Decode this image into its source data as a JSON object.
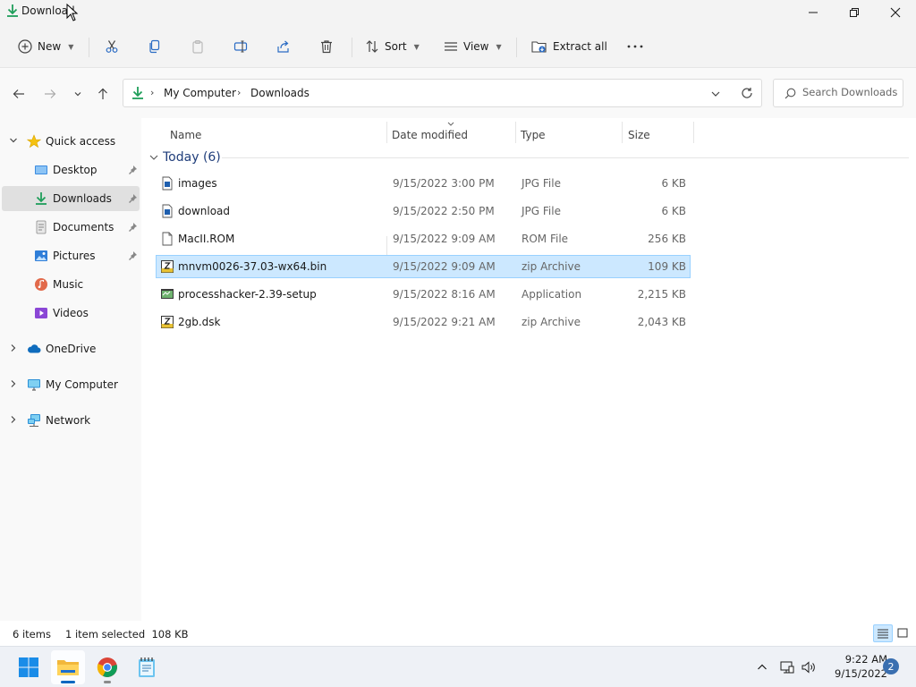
{
  "window": {
    "title": "Download"
  },
  "commandbar": {
    "new_label": "New",
    "sort_label": "Sort",
    "view_label": "View",
    "extract_label": "Extract all"
  },
  "address": {
    "crumbs": [
      "My Computer",
      "Downloads"
    ],
    "search_placeholder": "Search Downloads"
  },
  "sidebar": {
    "items": [
      {
        "label": "Quick access"
      },
      {
        "label": "Desktop"
      },
      {
        "label": "Downloads"
      },
      {
        "label": "Documents"
      },
      {
        "label": "Pictures"
      },
      {
        "label": "Music"
      },
      {
        "label": "Videos"
      },
      {
        "label": "OneDrive"
      },
      {
        "label": "My Computer"
      },
      {
        "label": "Network"
      }
    ]
  },
  "filelist": {
    "columns": [
      "Name",
      "Date modified",
      "Type",
      "Size"
    ],
    "group": "Today (6)",
    "rows": [
      {
        "name": "images",
        "date": "9/15/2022 3:00 PM",
        "type": "JPG File",
        "size": "6 KB"
      },
      {
        "name": "download",
        "date": "9/15/2022 2:50 PM",
        "type": "JPG File",
        "size": "6 KB"
      },
      {
        "name": "MacII.ROM",
        "date": "9/15/2022 9:09 AM",
        "type": "ROM File",
        "size": "256 KB"
      },
      {
        "name": "mnvm0026-37.03-wx64.bin",
        "date": "9/15/2022 9:09 AM",
        "type": "zip Archive",
        "size": "109 KB"
      },
      {
        "name": "processhacker-2.39-setup",
        "date": "9/15/2022 8:16 AM",
        "type": "Application",
        "size": "2,215 KB"
      },
      {
        "name": "2gb.dsk",
        "date": "9/15/2022 9:21 AM",
        "type": "zip Archive",
        "size": "2,043 KB"
      }
    ]
  },
  "status": {
    "count": "6 items",
    "selection": "1 item selected  108 KB"
  },
  "taskbar": {
    "time": "9:22 AM",
    "date": "9/15/2022",
    "notifications": "2"
  }
}
